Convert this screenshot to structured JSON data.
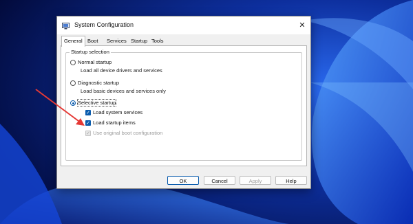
{
  "window": {
    "title": "System Configuration",
    "close_glyph": "✕"
  },
  "tabs": [
    {
      "label": "General",
      "active": true
    },
    {
      "label": "Boot"
    },
    {
      "label": "Services"
    },
    {
      "label": "Startup"
    },
    {
      "label": "Tools"
    }
  ],
  "startup": {
    "group_label": "Startup selection",
    "normal": {
      "label": "Normal startup",
      "desc": "Load all device drivers and services",
      "selected": false
    },
    "diagnostic": {
      "label": "Diagnostic startup",
      "desc": "Load basic devices and services only",
      "selected": false
    },
    "selective": {
      "label": "Selective startup",
      "selected": true
    },
    "options": [
      {
        "label": "Load system services",
        "checked": true,
        "enabled": true
      },
      {
        "label": "Load startup items",
        "checked": true,
        "enabled": true
      },
      {
        "label": "Use original boot configuration",
        "checked": true,
        "enabled": false
      }
    ]
  },
  "buttons": {
    "ok": "OK",
    "cancel": "Cancel",
    "apply": "Apply",
    "help": "Help"
  },
  "colors": {
    "accent": "#0b5cad",
    "annotation_arrow": "#e53935"
  }
}
